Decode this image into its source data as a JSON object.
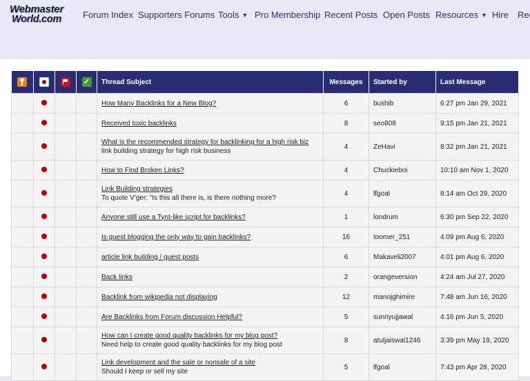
{
  "logo": {
    "line1": "Webmaster",
    "line2": "World.com"
  },
  "nav": [
    {
      "label": "Forum Index",
      "dropdown": false
    },
    {
      "label": "Supporters Forums",
      "dropdown": false
    },
    {
      "label": "Tools",
      "dropdown": true
    },
    {
      "label": "Pro Membership",
      "dropdown": false
    },
    {
      "label": "Recent Posts",
      "dropdown": false
    },
    {
      "label": "Open Posts",
      "dropdown": false
    },
    {
      "label": "Resources",
      "dropdown": true
    },
    {
      "label": "Hire",
      "dropdown": false
    },
    {
      "label": "Reg",
      "dropdown": false
    }
  ],
  "table": {
    "header_icons": [
      "pin-icon",
      "new-icon",
      "flag-icon",
      "check-icon"
    ],
    "columns": [
      "Thread Subject",
      "Messages",
      "Started by",
      "Last Message"
    ],
    "rows": [
      {
        "subject": "How Many Backlinks for a New Blog?",
        "subtitle": "",
        "messages": "6",
        "started_by": "bushib",
        "last_message": "6:27 pm Jan 29, 2021"
      },
      {
        "subject": "Received toxic backlinks",
        "subtitle": "",
        "messages": "8",
        "started_by": "seo808",
        "last_message": "9:15 pm Jan 21, 2021"
      },
      {
        "subject": "What is the recommended strategy for backlinking for a high risk biz",
        "subtitle": "link building strategy for high risk business",
        "messages": "4",
        "started_by": "ZeHavi",
        "last_message": "8:32 pm Jan 21, 2021"
      },
      {
        "subject": "How to Find Broken Links?",
        "subtitle": "",
        "messages": "4",
        "started_by": "Chuckieboi",
        "last_message": "10:10 am Nov 1, 2020"
      },
      {
        "subject": "Link Building strategies",
        "subtitle": "To quote V'ger: \"Is this all there is, is there nothing more?",
        "messages": "4",
        "started_by": "lfgoal",
        "last_message": "8:14 am Oct 29, 2020"
      },
      {
        "subject": "Anyone still use a Tynt-like script for backlinks?",
        "subtitle": "",
        "messages": "1",
        "started_by": "londrum",
        "last_message": "6:30 pm Sep 22, 2020"
      },
      {
        "subject": "Is guest blogging the only way to gain backlinks?",
        "subtitle": "",
        "messages": "16",
        "started_by": "toomer_251",
        "last_message": "4:09 pm Aug 6, 2020"
      },
      {
        "subject": "article link building / guest posts",
        "subtitle": "",
        "messages": "6",
        "started_by": "Makaveli2007",
        "last_message": "4:01 pm Aug 6, 2020"
      },
      {
        "subject": "Back links",
        "subtitle": "",
        "messages": "2",
        "started_by": "orangeversion",
        "last_message": "4:24 am Jul 27, 2020"
      },
      {
        "subject": "Backlink from wikipedia not displaying",
        "subtitle": "",
        "messages": "12",
        "started_by": "manojghimire",
        "last_message": "7:48 am Jun 16, 2020"
      },
      {
        "subject": "Are Backlinks from Forum discussion Helpful?",
        "subtitle": "",
        "messages": "5",
        "started_by": "sunnyujjawal",
        "last_message": "4:16 pm Jun 5, 2020"
      },
      {
        "subject": "How can I create good quality backlinks for my blog post?",
        "subtitle": "Need help to create good quality backlinks for my blog post",
        "messages": "8",
        "started_by": "atuljaiswal1246",
        "last_message": "3:39 pm May 19, 2020"
      },
      {
        "subject": "Link development and the sale or nonsale of a site",
        "subtitle": "Should I keep or sell my site",
        "messages": "5",
        "started_by": "lfgoal",
        "last_message": "7:43 pm Apr 28, 2020"
      }
    ]
  },
  "colors": {
    "header_bg": "#2b2d74",
    "nav_text": "#2a2f70",
    "dot": "#b00010",
    "page_bg": "#e7e8f3"
  }
}
